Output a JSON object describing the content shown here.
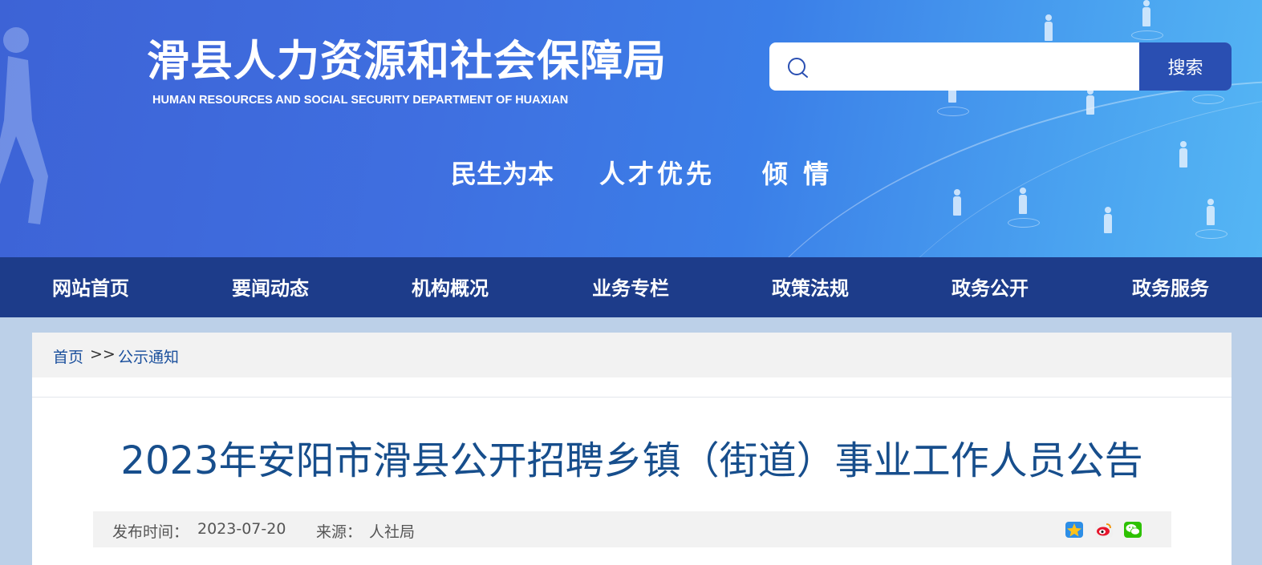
{
  "header": {
    "title": "滑县人力资源和社会保障局",
    "subtitle": "HUMAN RESOURCES AND SOCIAL SECURITY DEPARTMENT OF HUAXIAN",
    "slogans": [
      "民生为本",
      "人才优先",
      "倾 情"
    ]
  },
  "search": {
    "placeholder": "",
    "button_label": "搜索"
  },
  "nav": {
    "items": [
      "网站首页",
      "要闻动态",
      "机构概况",
      "业务专栏",
      "政策法规",
      "政务公开",
      "政务服务"
    ]
  },
  "breadcrumb": {
    "home": "首页",
    "separator": ">>",
    "current": "公示通知"
  },
  "article": {
    "title": "2023年安阳市滑县公开招聘乡镇（街道）事业工作人员公告",
    "publish_label": "发布时间：",
    "publish_date": "2023-07-20",
    "source_label": "来源：",
    "source": "人社局"
  },
  "share": {
    "icons": [
      "qzone-icon",
      "weibo-icon",
      "wechat-icon"
    ]
  },
  "colors": {
    "nav_bg": "#1d3c8a",
    "search_button": "#2a4fb2",
    "title": "#174e8c",
    "link": "#1a4f9c"
  }
}
